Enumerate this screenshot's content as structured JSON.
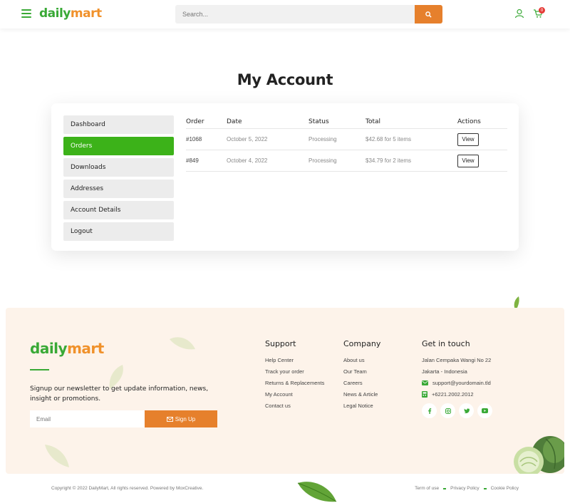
{
  "brand": {
    "logo_part1": "daily",
    "logo_part2": "mart"
  },
  "header": {
    "search_placeholder": "Search...",
    "cart_count": "0"
  },
  "account": {
    "title": "My Account",
    "menu": [
      {
        "label": "Dashboard",
        "active": false
      },
      {
        "label": "Orders",
        "active": true
      },
      {
        "label": "Downloads",
        "active": false
      },
      {
        "label": "Addresses",
        "active": false
      },
      {
        "label": "Account Details",
        "active": false
      },
      {
        "label": "Logout",
        "active": false
      }
    ],
    "table": {
      "headers": [
        "Order",
        "Date",
        "Status",
        "Total",
        "Actions"
      ],
      "rows": [
        {
          "order": "#1068",
          "date": "October 5, 2022",
          "status": "Processing",
          "total": "$42.68 for 5 items",
          "action": "View"
        },
        {
          "order": "#849",
          "date": "October 4, 2022",
          "status": "Processing",
          "total": "$34.79 for 2 items",
          "action": "View"
        }
      ]
    }
  },
  "footer": {
    "newsletter_text": "Signup our newsletter to get update information, news, insight or promotions.",
    "email_placeholder": "Email",
    "signup_label": "Sign Up",
    "support": {
      "title": "Support",
      "links": [
        "Help Center",
        "Track your order",
        "Returns & Replacements",
        "My Account",
        "Contact us"
      ]
    },
    "company": {
      "title": "Company",
      "links": [
        "About us",
        "Our Team",
        "Careers",
        "News & Article",
        "Legal Notice"
      ]
    },
    "contact": {
      "title": "Get in touch",
      "address_line1": "Jalan Cempaka Wangi No 22",
      "address_line2": "Jakarta - Indonesia",
      "email": "support@yourdomain.tld",
      "phone": "+6221.2002.2012"
    },
    "socials": [
      "facebook-icon",
      "instagram-icon",
      "twitter-icon",
      "youtube-icon"
    ],
    "copyright": "Copyright © 2022 DailyMart, All rights reserved. Powered by MoxCreative.",
    "legal_links": [
      "Term of use",
      "Privacy Policy",
      "Cookie Policy"
    ]
  },
  "colors": {
    "green": "#39a936",
    "orange": "#e6802c",
    "active_menu": "#3cb219",
    "footer_bg": "#fdf3ea"
  }
}
